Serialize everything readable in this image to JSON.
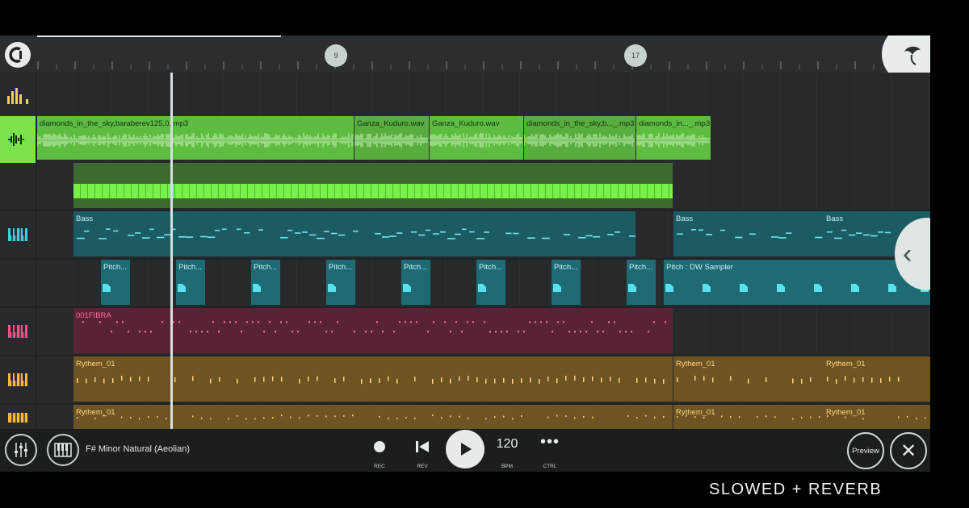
{
  "timeline": {
    "markers": [
      "9",
      "17"
    ]
  },
  "tracks": {
    "audio_clips": [
      {
        "label": "diamonds_in_the_sky,baraberev125,0,.mp3"
      },
      {
        "label": "Ganza_Kuduro.wav"
      },
      {
        "label": "Ganza_Kuduro.wav"
      },
      {
        "label": "diamonds_in_the_sky,b..._.mp3"
      },
      {
        "label": "diamonds_in..._.mp3"
      }
    ],
    "bass_clips": [
      {
        "label": "Bass"
      },
      {
        "label": "Bass"
      },
      {
        "label": "Bass"
      }
    ],
    "pitch_clips": [
      {
        "label": "Pitch..."
      },
      {
        "label": "Pitch..."
      },
      {
        "label": "Pitch..."
      },
      {
        "label": "Pitch..."
      },
      {
        "label": "Pitch..."
      },
      {
        "label": "Pitch..."
      },
      {
        "label": "Pitch..."
      },
      {
        "label": "Pitch..."
      },
      {
        "label": "Pitch : DW Sampler"
      }
    ],
    "fibra_clip": {
      "label": "001FIBRA"
    },
    "rythem_clips_row1": [
      {
        "label": "Rythem_01"
      },
      {
        "label": "Rythem_01"
      },
      {
        "label": "Rythem_01"
      }
    ],
    "rythem_clips_row2": [
      {
        "label": "Rythem_01"
      },
      {
        "label": "Rythem_01"
      },
      {
        "label": "Rythem_01"
      }
    ]
  },
  "bottombar": {
    "scale": "F# Minor Natural (Aeolian)",
    "rec_label": "REC",
    "rev_label": "REV",
    "bpm_value": "120",
    "bpm_label": "BPM",
    "ctrl_label": "CTRL",
    "preview_label": "Preview"
  },
  "watermark": "SLOWED + REVERB",
  "colors": {
    "accent_green": "#7be24c",
    "audio_clip": "#5fbc42",
    "teal": "#1d5b62",
    "pink": "#5a2238",
    "gold": "#6e5422"
  },
  "icons": [
    "logo-icon",
    "mixer-icon",
    "piano-icon",
    "record-icon",
    "rewind-icon",
    "play-icon",
    "more-icon",
    "close-icon",
    "chevron-left-icon",
    "fruit-logo-icon"
  ]
}
